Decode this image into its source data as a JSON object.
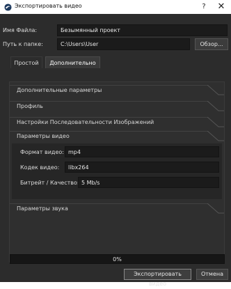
{
  "window": {
    "title": "Экспортировать видео",
    "help_label": "?",
    "close_label": "✕"
  },
  "form": {
    "filename_label": "Имя Файла:",
    "filename_value": "Безымянный проект",
    "folder_label": "Путь к папке:",
    "folder_value": "C:\\Users\\User",
    "browse_label": "Обзор..."
  },
  "tabs": [
    {
      "label": "Простой",
      "active": false
    },
    {
      "label": "Дополнительно",
      "active": true
    }
  ],
  "sections": {
    "advanced": "Дополнительные параметры",
    "profile": "Профиль",
    "image_sequence": "Настройки Последовательности Изображений",
    "video": "Параметры видео",
    "audio": "Параметры звука"
  },
  "video": {
    "format_label": "Формат видео:",
    "format_value": "mp4",
    "codec_label": "Кодек видео:",
    "codec_value": "libx264",
    "bitrate_label": "Битрейт / Качество:",
    "bitrate_value": "5 Mb/s"
  },
  "progress": {
    "text": "0%",
    "value": 0
  },
  "buttons": {
    "export_label": "Экспортировать видео",
    "cancel_label": "Отмена"
  },
  "colors": {
    "background": "#2c2c2c",
    "input_background": "#1b1b1b",
    "text": "#e6e6e6"
  }
}
